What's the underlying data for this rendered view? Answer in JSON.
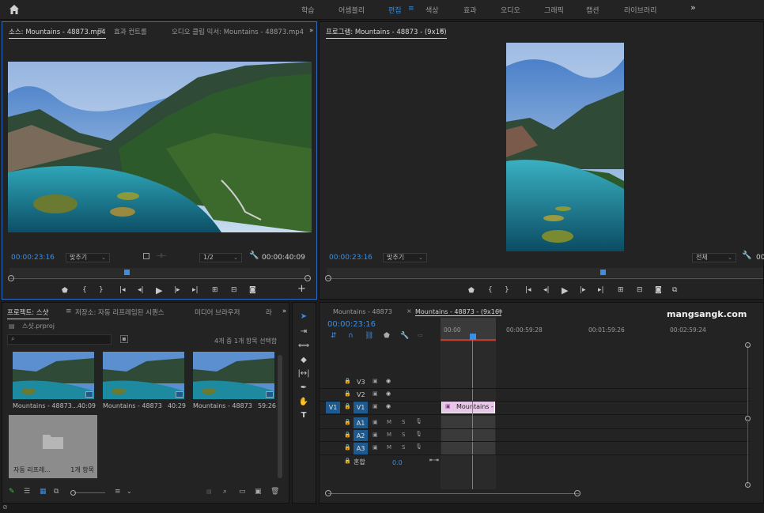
{
  "workspace_bar": {
    "items": [
      "학습",
      "어셈블리",
      "편집",
      "색상",
      "효과",
      "오디오",
      "그래픽",
      "캡션",
      "라이브러리"
    ],
    "active": "편집",
    "active_menu_glyph": "≡",
    "more": "»"
  },
  "source_panel": {
    "tabs": [
      "소스: Mountains - 48873.mp4",
      "효과 컨트롤",
      "오디오 클립 믹서: Mountains - 48873.mp4"
    ],
    "menu_glyph": "≡",
    "more": "»",
    "timecode": "00:00:23:16",
    "fit": "맞추기",
    "resolution": "1/2",
    "duration": "00:00:40:09",
    "add": "+"
  },
  "program_panel": {
    "title": "프로그램: Mountains - 48873 - (9x16)",
    "menu_glyph": "≡",
    "timecode": "00:00:23:16",
    "fit": "맞추기",
    "full": "전체",
    "duration_partial": "00"
  },
  "project_panel": {
    "tabs": [
      "프로젝트: 스샷",
      "저장소: 자동 리프레임된 시퀀스",
      "미디어 브라우저",
      "라"
    ],
    "menu_glyph": "≡",
    "more": "»",
    "project_file": "스샷.prproj",
    "search_placeholder": "",
    "selection_status": "4개 중 1개 항목 선택함",
    "items": [
      {
        "name": "Mountains - 48873...",
        "duration": "40:09"
      },
      {
        "name": "Mountains - 48873",
        "duration": "40:29"
      },
      {
        "name": "Mountains - 48873",
        "duration": "59:26"
      }
    ],
    "bin": {
      "name": "자동 리프레...",
      "count": "1개 항목"
    }
  },
  "timeline_panel": {
    "tabs": [
      "Mountains - 48873",
      "Mountains - 48873 - (9x16)"
    ],
    "active_tab_marker": "×",
    "menu_glyph": "≡",
    "timecode": "00:00:23:16",
    "ruler": [
      "00:00",
      "00:00:59:28",
      "00:01:59:26",
      "00:02:59:24"
    ],
    "watermark": "mangsangk.com",
    "video_tracks": [
      "V3",
      "V2",
      "V1"
    ],
    "source_patch": "V1",
    "audio_tracks": [
      "A1",
      "A2",
      "A3"
    ],
    "mix_label": "혼합",
    "mix_value": "0.0",
    "clip_label": "Mountains -",
    "m_label": "M",
    "s_label": "S"
  },
  "colors": {
    "accent": "#2d8ceb",
    "panel_bg": "#232323",
    "app_bg": "#1d1d1d",
    "clip_pink": "#e8c6e8",
    "track_selected": "#1f5a8f"
  }
}
